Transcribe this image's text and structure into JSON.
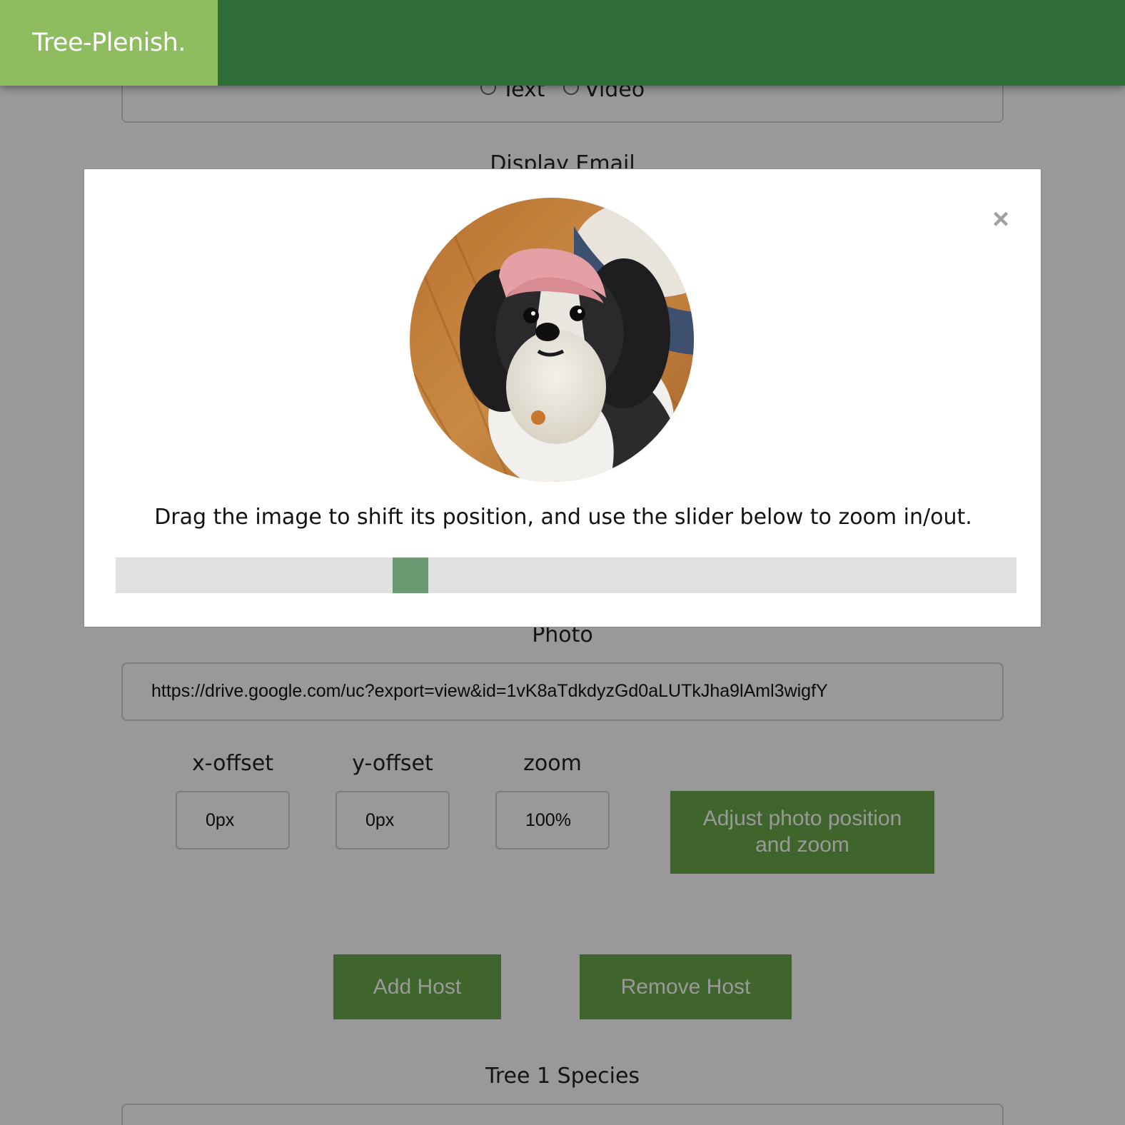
{
  "app": {
    "logo": "Tree-Plenish."
  },
  "form": {
    "radio_options": [
      "Text",
      "Video"
    ],
    "display_email_label": "Display Email",
    "photo_label": "Photo",
    "photo_url": "https://drive.google.com/uc?export=view&id=1vK8aTdkdyzGd0aLUTkJha9lAml3wigfY",
    "x_offset_label": "x-offset",
    "x_offset_value": "0px",
    "y_offset_label": "y-offset",
    "y_offset_value": "0px",
    "zoom_label": "zoom",
    "zoom_value": "100%",
    "adjust_button": "Adjust photo position and zoom",
    "add_host_button": "Add Host",
    "remove_host_button": "Remove Host",
    "tree_species_label": "Tree 1 Species"
  },
  "modal": {
    "close_glyph": "×",
    "instruction": "Drag the image to shift its position, and use the slider below to zoom in/out.",
    "zoom_slider_fraction": 0.32,
    "accent_color": "#6a9a72"
  },
  "icons": {
    "close": "close-icon",
    "photo": "dog-photo"
  },
  "colors": {
    "header": "#2f6e38",
    "logo_bg": "#8fbc5f",
    "button": "#69a84a"
  }
}
